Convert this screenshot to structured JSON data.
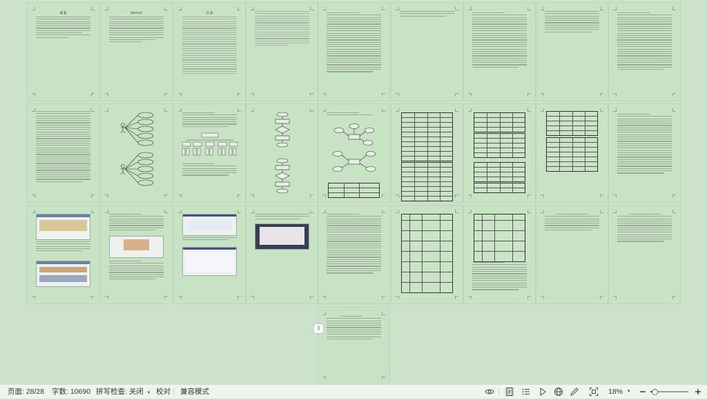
{
  "status_bar": {
    "page_indicator": "页面: 28/28",
    "word_count": "字数: 10690",
    "spell_check": "拼写检查: 关闭",
    "proofread": "校对",
    "compat_mode": "兼容模式",
    "zoom_level": "18%",
    "zoom_slider_fraction": 0.1,
    "icons": [
      "eye-icon",
      "page-view-icon",
      "outline-view-icon",
      "play-icon",
      "web-layout-icon",
      "pen-icon",
      "fit-window-icon",
      "zoom-out-icon",
      "zoom-in-icon"
    ]
  },
  "document": {
    "page_headings": [
      "摘 要",
      "Abstract",
      "目 录"
    ]
  },
  "colors": {
    "page_background": "#c8e2c4",
    "workspace_background": "#cde2ca",
    "status_bar_background": "#f1f3f1"
  }
}
